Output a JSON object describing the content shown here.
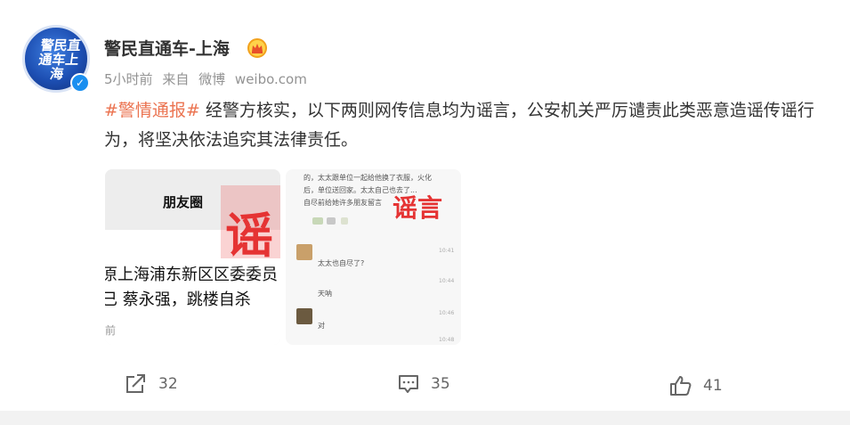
{
  "author": {
    "name": "警民直通车-上海",
    "avatar_text": "警民直通车上海",
    "badge_icon": "crown-icon",
    "verified_icon": "verified-check-icon"
  },
  "meta": {
    "time": "5小时前",
    "source_prefix": "来自",
    "source_app": "微博",
    "source_site": "weibo.com"
  },
  "post": {
    "hashtag": "#警情通报#",
    "text": " 经警方核实，以下两则网传信息均为谣言，公安机关严厉谴责此类恶意造谣传谣行为，将坚决依法追究其法律责任。"
  },
  "images": {
    "first": {
      "header": "朋友圈",
      "line1": "原上海浦东新区区委委员",
      "line2": "已 蔡永强，跳楼自杀",
      "stamp": "谣",
      "foot": "前"
    },
    "second": {
      "line1": "的，太太跟单位一起给他换了衣服，火化",
      "line2": "后，单位送回家。太太自己也去了...",
      "line3": "自尽前给她许多朋友留言",
      "msg1": "太太也自尽了?",
      "msg2": "天呐",
      "msg3": "对",
      "time1": "10:41",
      "time2": "10:44",
      "time3": "10:46",
      "time4": "10:48",
      "stamp": "谣言"
    }
  },
  "actions": {
    "share_count": "32",
    "comment_count": "35",
    "like_count": "41",
    "share_icon": "share-icon",
    "comment_icon": "comment-icon",
    "like_icon": "thumbs-up-icon"
  },
  "colors": {
    "hashtag": "#eb7350",
    "verified": "#1a8ff0",
    "stamp_red": "#e53333"
  }
}
